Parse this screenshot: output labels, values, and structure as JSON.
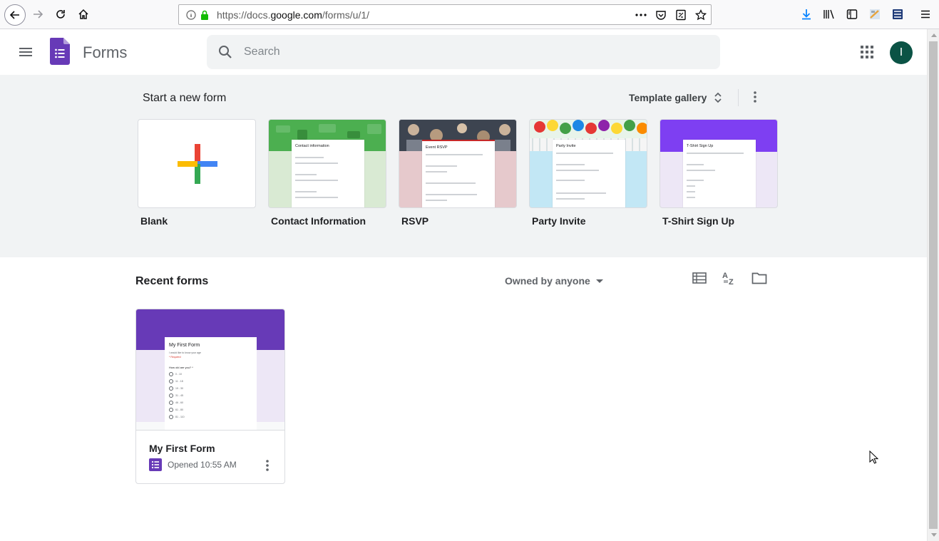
{
  "browser": {
    "url_prefix": "https://docs.",
    "url_domain": "google.com",
    "url_path": "/forms/u/1/"
  },
  "app": {
    "title": "Forms",
    "search_placeholder": "Search",
    "avatar_initial": "I"
  },
  "templates": {
    "heading": "Start a new form",
    "gallery_label": "Template gallery",
    "items": [
      {
        "label": "Blank"
      },
      {
        "label": "Contact Information",
        "form_title": "Contact information"
      },
      {
        "label": "RSVP",
        "form_title": "Event RSVP"
      },
      {
        "label": "Party Invite",
        "form_title": "Party Invite"
      },
      {
        "label": "T-Shirt Sign Up",
        "form_title": "T-Shirt Sign Up"
      }
    ]
  },
  "recent": {
    "heading": "Recent forms",
    "owner_filter": "Owned by anyone",
    "documents": [
      {
        "title": "My First Form",
        "meta": "Opened 10:55 AM",
        "thumb": {
          "title": "My First Form",
          "subtitle": "I would like to know your age",
          "required": "* Required",
          "question": "How old are you? *",
          "options": [
            "0 - 10",
            "11 - 18",
            "19 - 30",
            "31 - 45",
            "46 - 60",
            "61 - 80",
            "81 - 110"
          ]
        }
      }
    ]
  },
  "colors": {
    "forms_purple": "#673ab7",
    "avatar_bg": "#0b5345",
    "template_bg": "#f1f3f4"
  }
}
